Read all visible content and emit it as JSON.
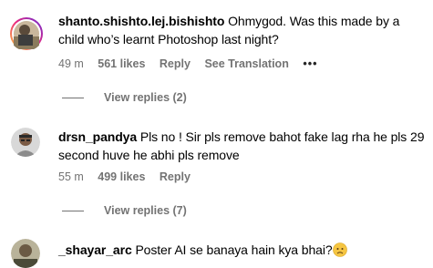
{
  "comments": [
    {
      "username": "shanto.shishto.lej.bishishto",
      "text": "Ohmygod. Was this made by a child who’s learnt Photoshop last night?",
      "time": "49 m",
      "likes": "561 likes",
      "reply": "Reply",
      "translate": "See Translation",
      "more": "•••",
      "view_replies": "View replies (2)"
    },
    {
      "username": "drsn_pandya",
      "text": "Pls no ! Sir pls remove bahot fake lag rha he pls 29 second huve he abhi pls remove",
      "time": "55 m",
      "likes": "499 likes",
      "reply": "Reply",
      "view_replies": "View replies (7)"
    },
    {
      "username": "_shayar_arc",
      "text": "Poster AI se banaya hain kya bhai?",
      "emoji": "worried-face-emoji"
    }
  ],
  "colors": {
    "text": "#000000",
    "secondary": "#737373",
    "story_ring_start": "#f9ce34",
    "story_ring_end": "#c913b9"
  }
}
